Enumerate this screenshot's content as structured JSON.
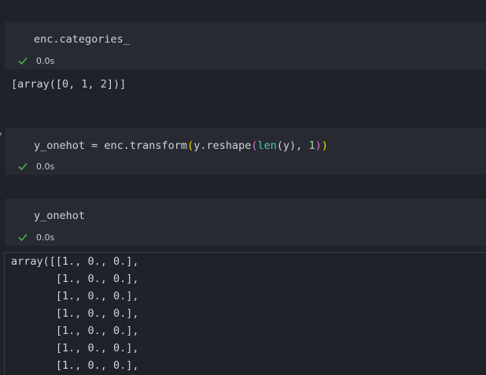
{
  "cells": [
    {
      "code": "enc.categories_",
      "status": "0.0s",
      "output": "[array([0, 1, 2])]"
    },
    {
      "code_tokens": {
        "t1": "y_onehot = enc.transform",
        "t2": "(",
        "t3": "y.reshape",
        "t4": "(",
        "t5": "len",
        "t6": "(y)",
        "t7": ", ",
        "t8": "1",
        "t9": ")",
        "t10": ")"
      },
      "status": "0.0s"
    },
    {
      "code": "y_onehot",
      "status": "0.0s",
      "output_lines": [
        "array([[1., 0., 0.],",
        "       [1., 0., 0.],",
        "       [1., 0., 0.],",
        "       [1., 0., 0.],",
        "       [1., 0., 0.],",
        "       [1., 0., 0.],",
        "       [1., 0., 0.],"
      ]
    }
  ],
  "colors": {
    "background": "#1f2228",
    "cell_background": "#272b31",
    "success_check": "#4caf50",
    "bracket_level1": "#ffd700",
    "bracket_level2": "#da70d6",
    "builtin": "#4ec9b0"
  },
  "icons": {
    "status": "check-icon"
  }
}
